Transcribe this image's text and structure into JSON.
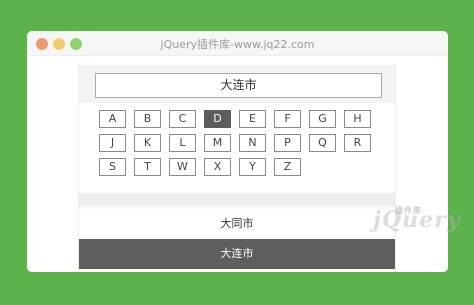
{
  "window": {
    "title": "jQuery插件库-www.jq22.com"
  },
  "search": {
    "value": "大连市"
  },
  "letters": [
    {
      "label": "A"
    },
    {
      "label": "B"
    },
    {
      "label": "C"
    },
    {
      "label": "D",
      "active": true
    },
    {
      "label": "E"
    },
    {
      "label": "F"
    },
    {
      "label": "G"
    },
    {
      "label": "H"
    },
    {
      "label": "J"
    },
    {
      "label": "K"
    },
    {
      "label": "L"
    },
    {
      "label": "M"
    },
    {
      "label": "N"
    },
    {
      "label": "P"
    },
    {
      "label": "Q"
    },
    {
      "label": "R"
    },
    {
      "label": "S"
    },
    {
      "label": "T"
    },
    {
      "label": "W"
    },
    {
      "label": "X"
    },
    {
      "label": "Y"
    },
    {
      "label": "Z"
    }
  ],
  "cities": [
    {
      "label": "大同市",
      "selected": false
    },
    {
      "label": "大连市",
      "selected": true
    }
  ],
  "logo": {
    "text": "jQuery",
    "cn": "插件库"
  },
  "colors": {
    "background": "#5cb24c",
    "active": "#5c5c5c"
  }
}
